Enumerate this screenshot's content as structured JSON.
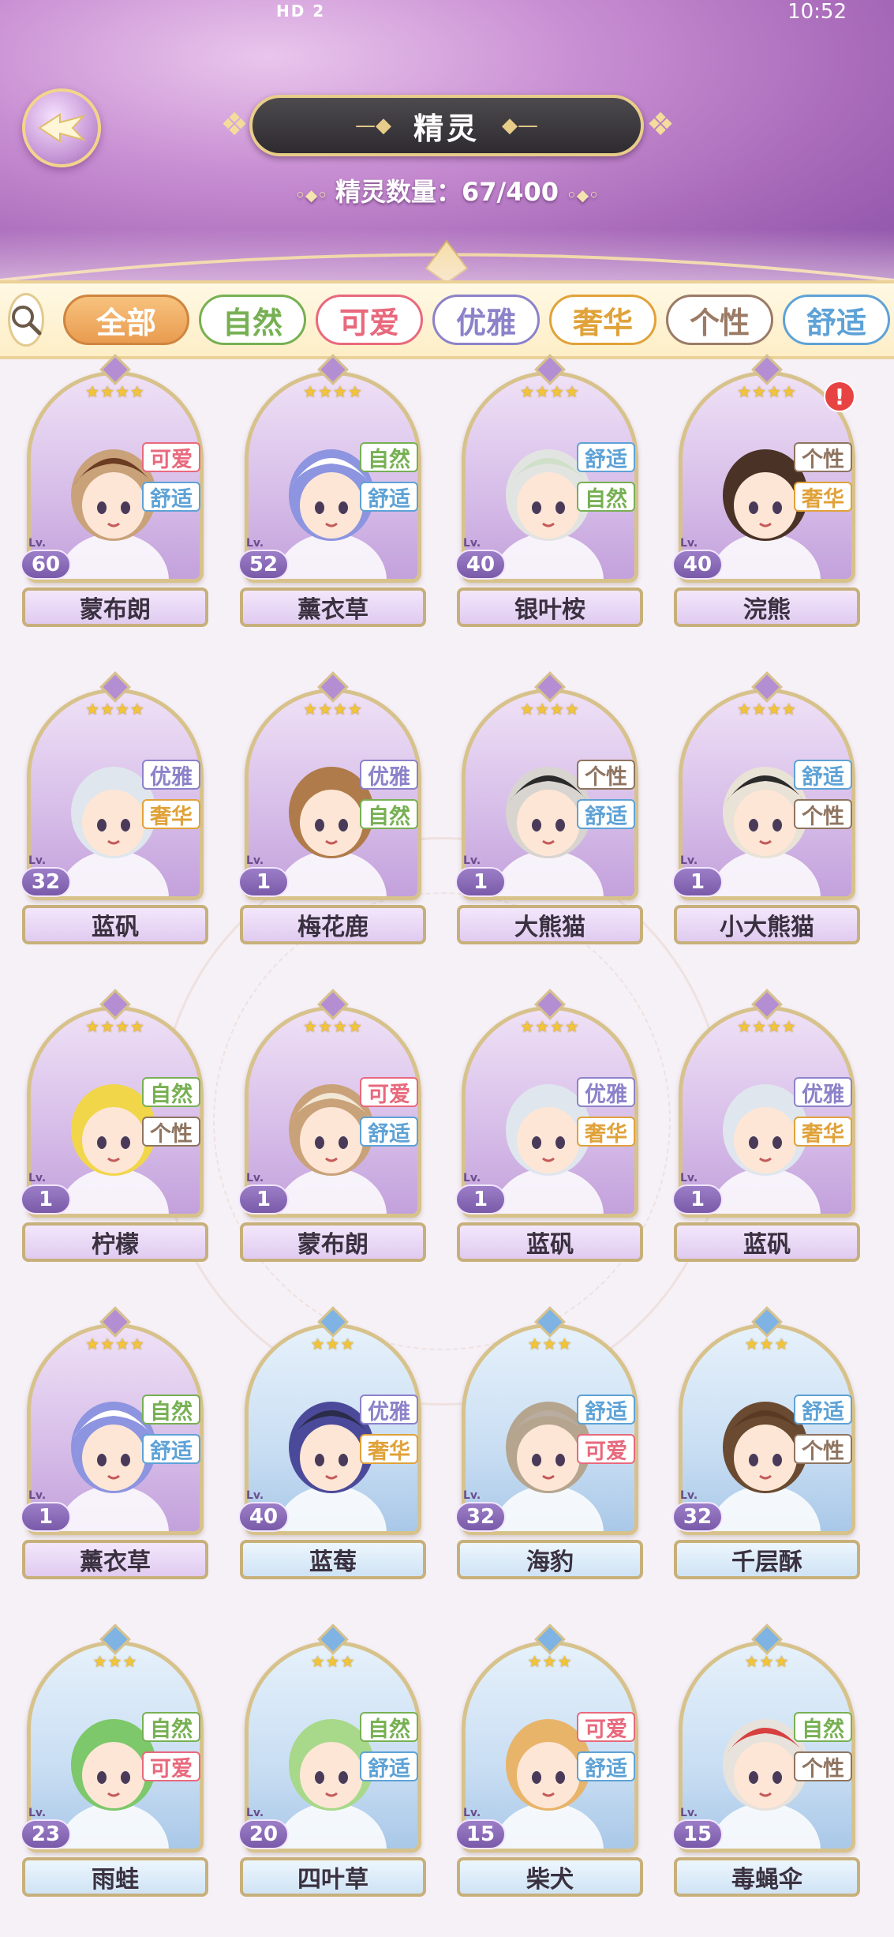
{
  "status": {
    "left": "HD 2",
    "right": "10:52"
  },
  "header": {
    "title": "精灵",
    "count_label": "精灵数量：67/400"
  },
  "filters": [
    {
      "label": "全部",
      "color": "#e99c50",
      "active": true
    },
    {
      "label": "自然",
      "color": "#77b053"
    },
    {
      "label": "可爱",
      "color": "#e8697d"
    },
    {
      "label": "优雅",
      "color": "#8c82c9"
    },
    {
      "label": "奢华",
      "color": "#e0a23a"
    },
    {
      "label": "个性",
      "color": "#9b7b66"
    },
    {
      "label": "舒适",
      "color": "#5ea2d6"
    }
  ],
  "tag_colors": {
    "自然": "#77b053",
    "可爱": "#e8697d",
    "优雅": "#8c82c9",
    "奢华": "#e0a23a",
    "个性": "#8f7460",
    "舒适": "#5ea2d6"
  },
  "cards": [
    {
      "name": "蒙布朗",
      "level": "60",
      "stars": "★★★★",
      "tags": [
        "可爱",
        "舒适"
      ],
      "frame": "purple",
      "hair": "#c9a27a",
      "hat": "#6b3b22"
    },
    {
      "name": "薰衣草",
      "level": "52",
      "stars": "★★★★",
      "tags": [
        "自然",
        "舒适"
      ],
      "frame": "purple",
      "hair": "#8d94e0",
      "hat": "#ffffff"
    },
    {
      "name": "银叶桉",
      "level": "40",
      "stars": "★★★★",
      "tags": [
        "舒适",
        "自然"
      ],
      "frame": "purple",
      "hair": "#e2e4e2",
      "hat": "#cfe0c9"
    },
    {
      "name": "浣熊",
      "level": "40",
      "stars": "★★★★",
      "tags": [
        "个性",
        "奢华"
      ],
      "frame": "purple",
      "hair": "#4a3226",
      "hat": "#4a3226",
      "alert": "!"
    },
    {
      "name": "蓝矾",
      "level": "32",
      "stars": "★★★★",
      "tags": [
        "优雅",
        "奢华"
      ],
      "frame": "purple",
      "hair": "#dfe6ee",
      "hat": "#dfe6ee"
    },
    {
      "name": "梅花鹿",
      "level": "1",
      "stars": "★★★★",
      "tags": [
        "优雅",
        "自然"
      ],
      "frame": "purple",
      "hair": "#b07b4a",
      "hat": "#b07b4a"
    },
    {
      "name": "大熊猫",
      "level": "1",
      "stars": "★★★★",
      "tags": [
        "个性",
        "舒适"
      ],
      "frame": "purple",
      "hair": "#d8d4cf",
      "hat": "#2b2b2b"
    },
    {
      "name": "小大熊猫",
      "level": "1",
      "stars": "★★★★",
      "tags": [
        "舒适",
        "个性"
      ],
      "frame": "purple",
      "hair": "#e9e2d6",
      "hat": "#2b2b2b"
    },
    {
      "name": "柠檬",
      "level": "1",
      "stars": "★★★★",
      "tags": [
        "自然",
        "个性"
      ],
      "frame": "purple",
      "hair": "#f1d64a",
      "hat": "#f1d64a"
    },
    {
      "name": "蒙布朗",
      "level": "1",
      "stars": "★★★★",
      "tags": [
        "可爱",
        "舒适"
      ],
      "frame": "purple",
      "hair": "#c9a27a",
      "hat": "#f3e8d6"
    },
    {
      "name": "蓝矾",
      "level": "1",
      "stars": "★★★★",
      "tags": [
        "优雅",
        "奢华"
      ],
      "frame": "purple",
      "hair": "#dfe6ee",
      "hat": "#dfe6ee"
    },
    {
      "name": "蓝矾",
      "level": "1",
      "stars": "★★★★",
      "tags": [
        "优雅",
        "奢华"
      ],
      "frame": "purple",
      "hair": "#dfe6ee",
      "hat": "#dfe6ee"
    },
    {
      "name": "薰衣草",
      "level": "1",
      "stars": "★★★★",
      "tags": [
        "自然",
        "舒适"
      ],
      "frame": "purple",
      "hair": "#8d94e0",
      "hat": "#ffffff"
    },
    {
      "name": "蓝莓",
      "level": "40",
      "stars": "★★★",
      "tags": [
        "优雅",
        "奢华"
      ],
      "frame": "blue",
      "hair": "#4b4a9a",
      "hat": "#2b2b4a"
    },
    {
      "name": "海豹",
      "level": "32",
      "stars": "★★★",
      "tags": [
        "舒适",
        "可爱"
      ],
      "frame": "blue",
      "hair": "#b5a58e",
      "hat": "#b8ada0"
    },
    {
      "name": "千层酥",
      "level": "32",
      "stars": "★★★",
      "tags": [
        "舒适",
        "个性"
      ],
      "frame": "blue",
      "hair": "#6a4a30",
      "hat": "#5a3a24"
    },
    {
      "name": "雨蛙",
      "level": "23",
      "stars": "★★★",
      "tags": [
        "自然",
        "可爱"
      ],
      "frame": "blue",
      "hair": "#7cc86a",
      "hat": "#7cc86a"
    },
    {
      "name": "四叶草",
      "level": "20",
      "stars": "★★★",
      "tags": [
        "自然",
        "舒适"
      ],
      "frame": "blue",
      "hair": "#a8d88a",
      "hat": "#a8d88a"
    },
    {
      "name": "柴犬",
      "level": "15",
      "stars": "★★★",
      "tags": [
        "可爱",
        "舒适"
      ],
      "frame": "blue",
      "hair": "#e8b46a",
      "hat": "#e8b46a"
    },
    {
      "name": "毒蝇伞",
      "level": "15",
      "stars": "★★★",
      "tags": [
        "自然",
        "个性"
      ],
      "frame": "blue",
      "hair": "#e8e2dc",
      "hat": "#d84040"
    }
  ]
}
